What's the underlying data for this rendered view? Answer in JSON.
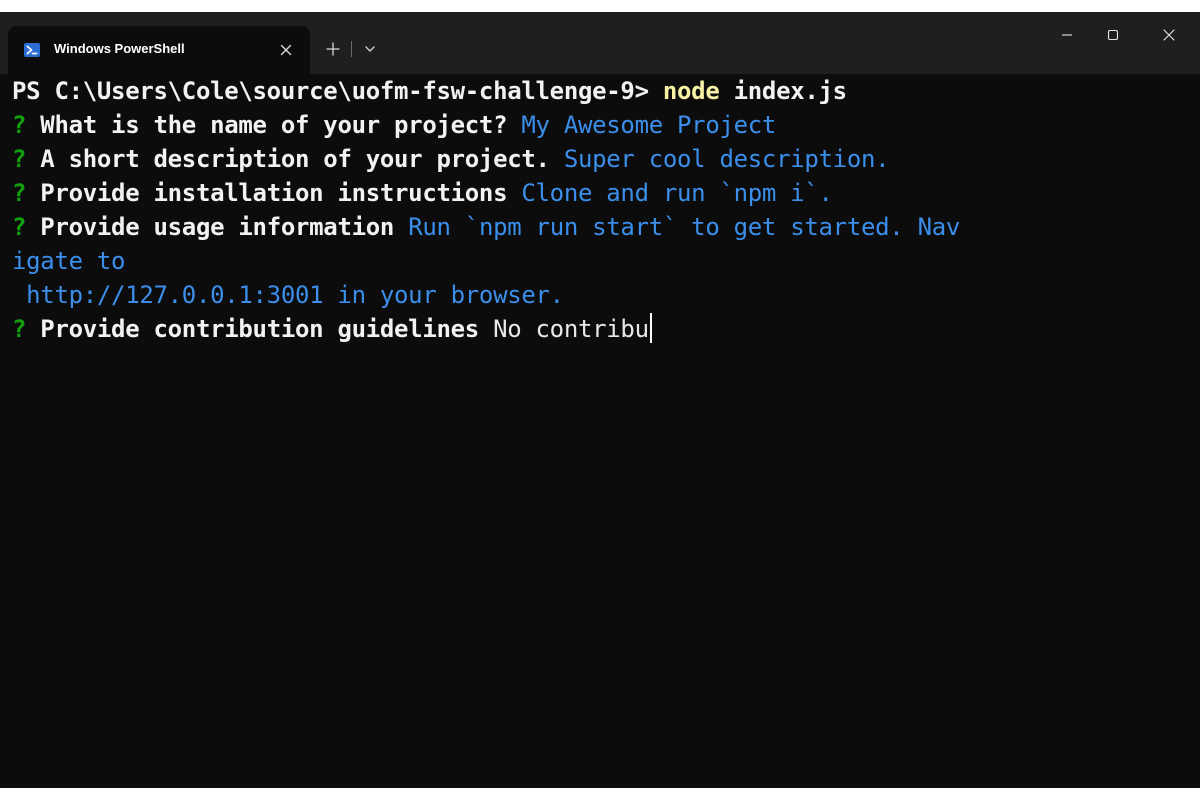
{
  "tab": {
    "title": "Windows PowerShell",
    "icon": "powershell-icon",
    "close_icon": "close-icon"
  },
  "titlebar": {
    "new_tab_icon": "plus-icon",
    "dropdown_icon": "chevron-down-icon",
    "minimize_icon": "minimize-icon",
    "maximize_icon": "maximize-icon",
    "close_icon": "close-icon"
  },
  "terminal": {
    "prompt": "PS C:\\Users\\Cole\\source\\uofm-fsw-challenge-9> ",
    "command": "node",
    "command_args": " index.js",
    "questions": [
      {
        "marker": "?",
        "question": " What is the name of your project?",
        "answer": " My Awesome Project"
      },
      {
        "marker": "?",
        "question": " A short description of your project.",
        "answer": " Super cool description."
      },
      {
        "marker": "?",
        "question": " Provide installation instructions",
        "answer": " Clone and run `npm i`."
      },
      {
        "marker": "?",
        "question": " Provide usage information",
        "answer": " Run `npm run start` to get started. Nav",
        "answer_wrap_1": "igate to",
        "answer_wrap_2": " http://127.0.0.1:3001 in your browser."
      },
      {
        "marker": "?",
        "question": " Provide contribution guidelines",
        "answer": " No contribu"
      }
    ]
  },
  "colors": {
    "background": "#0c0c0c",
    "titlebar": "#1f1f1f",
    "question_marker": "#13a10e",
    "answer": "#3b8eea",
    "command": "#f9f1a5",
    "text": "#f2f2f2"
  }
}
